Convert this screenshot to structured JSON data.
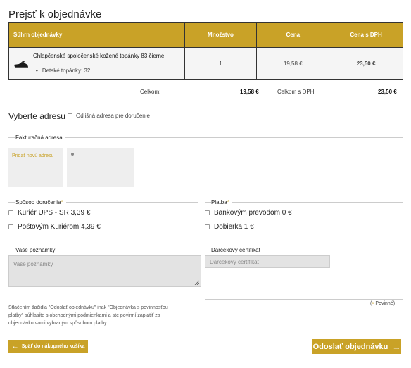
{
  "page": {
    "title": "Prejsť k objednávke"
  },
  "table": {
    "headers": [
      "Súhrn objednávky",
      "Množstvo",
      "Cena",
      "Cena s DPH"
    ],
    "rows": [
      {
        "name": "Chlapčenské spoločenské kožené topánky 83 čierne",
        "attribute": "Detské topánky: 32",
        "quantity": "1",
        "price": "19,58 €",
        "price_vat": "23,50 €"
      }
    ]
  },
  "totals": {
    "label": "Celkom:",
    "value": "19,58 €",
    "label_vat": "Celkom s DPH:",
    "value_vat": "23,50 €"
  },
  "address": {
    "title": "Vyberte adresu",
    "different_delivery": "Odlišná adresa pre doručenie",
    "billing_legend": "Fakturačná adresa",
    "add_new": "Pridať novú adresu"
  },
  "shipping": {
    "legend": "Spôsob doručenia",
    "options": [
      "Kuriér UPS - SR 3,39 €",
      "Poštovým Kuriérom 4,39 €"
    ]
  },
  "payment": {
    "legend": "Platba",
    "options": [
      "Bankovým prevodom 0 €",
      "Dobierka 1 €"
    ]
  },
  "notes": {
    "legend": "Vaše poznámky",
    "placeholder": "Vaše poznámky"
  },
  "gift": {
    "legend": "Darčekový certifikát",
    "placeholder": "Darčekový certifikát"
  },
  "terms": "Stlačením tlačidla \"Odoslať objednávku\" inak \"Objednávka s povinnosťou platby\" súhlasíte s obchodnými podmienkami a ste povinní zaplatiť za objednávku vami vybraným spôsobom platby..",
  "mandatory": {
    "star": "*",
    "label": "Povinné)"
  },
  "buttons": {
    "back": "Späť do nákupného košíka",
    "submit": "Odoslať objednávku"
  },
  "colors": {
    "accent": "#c9a227",
    "field_bg": "#e3e3e3"
  },
  "icons": {
    "back": "arrow-left-icon",
    "submit": "arrow-right-icon"
  }
}
